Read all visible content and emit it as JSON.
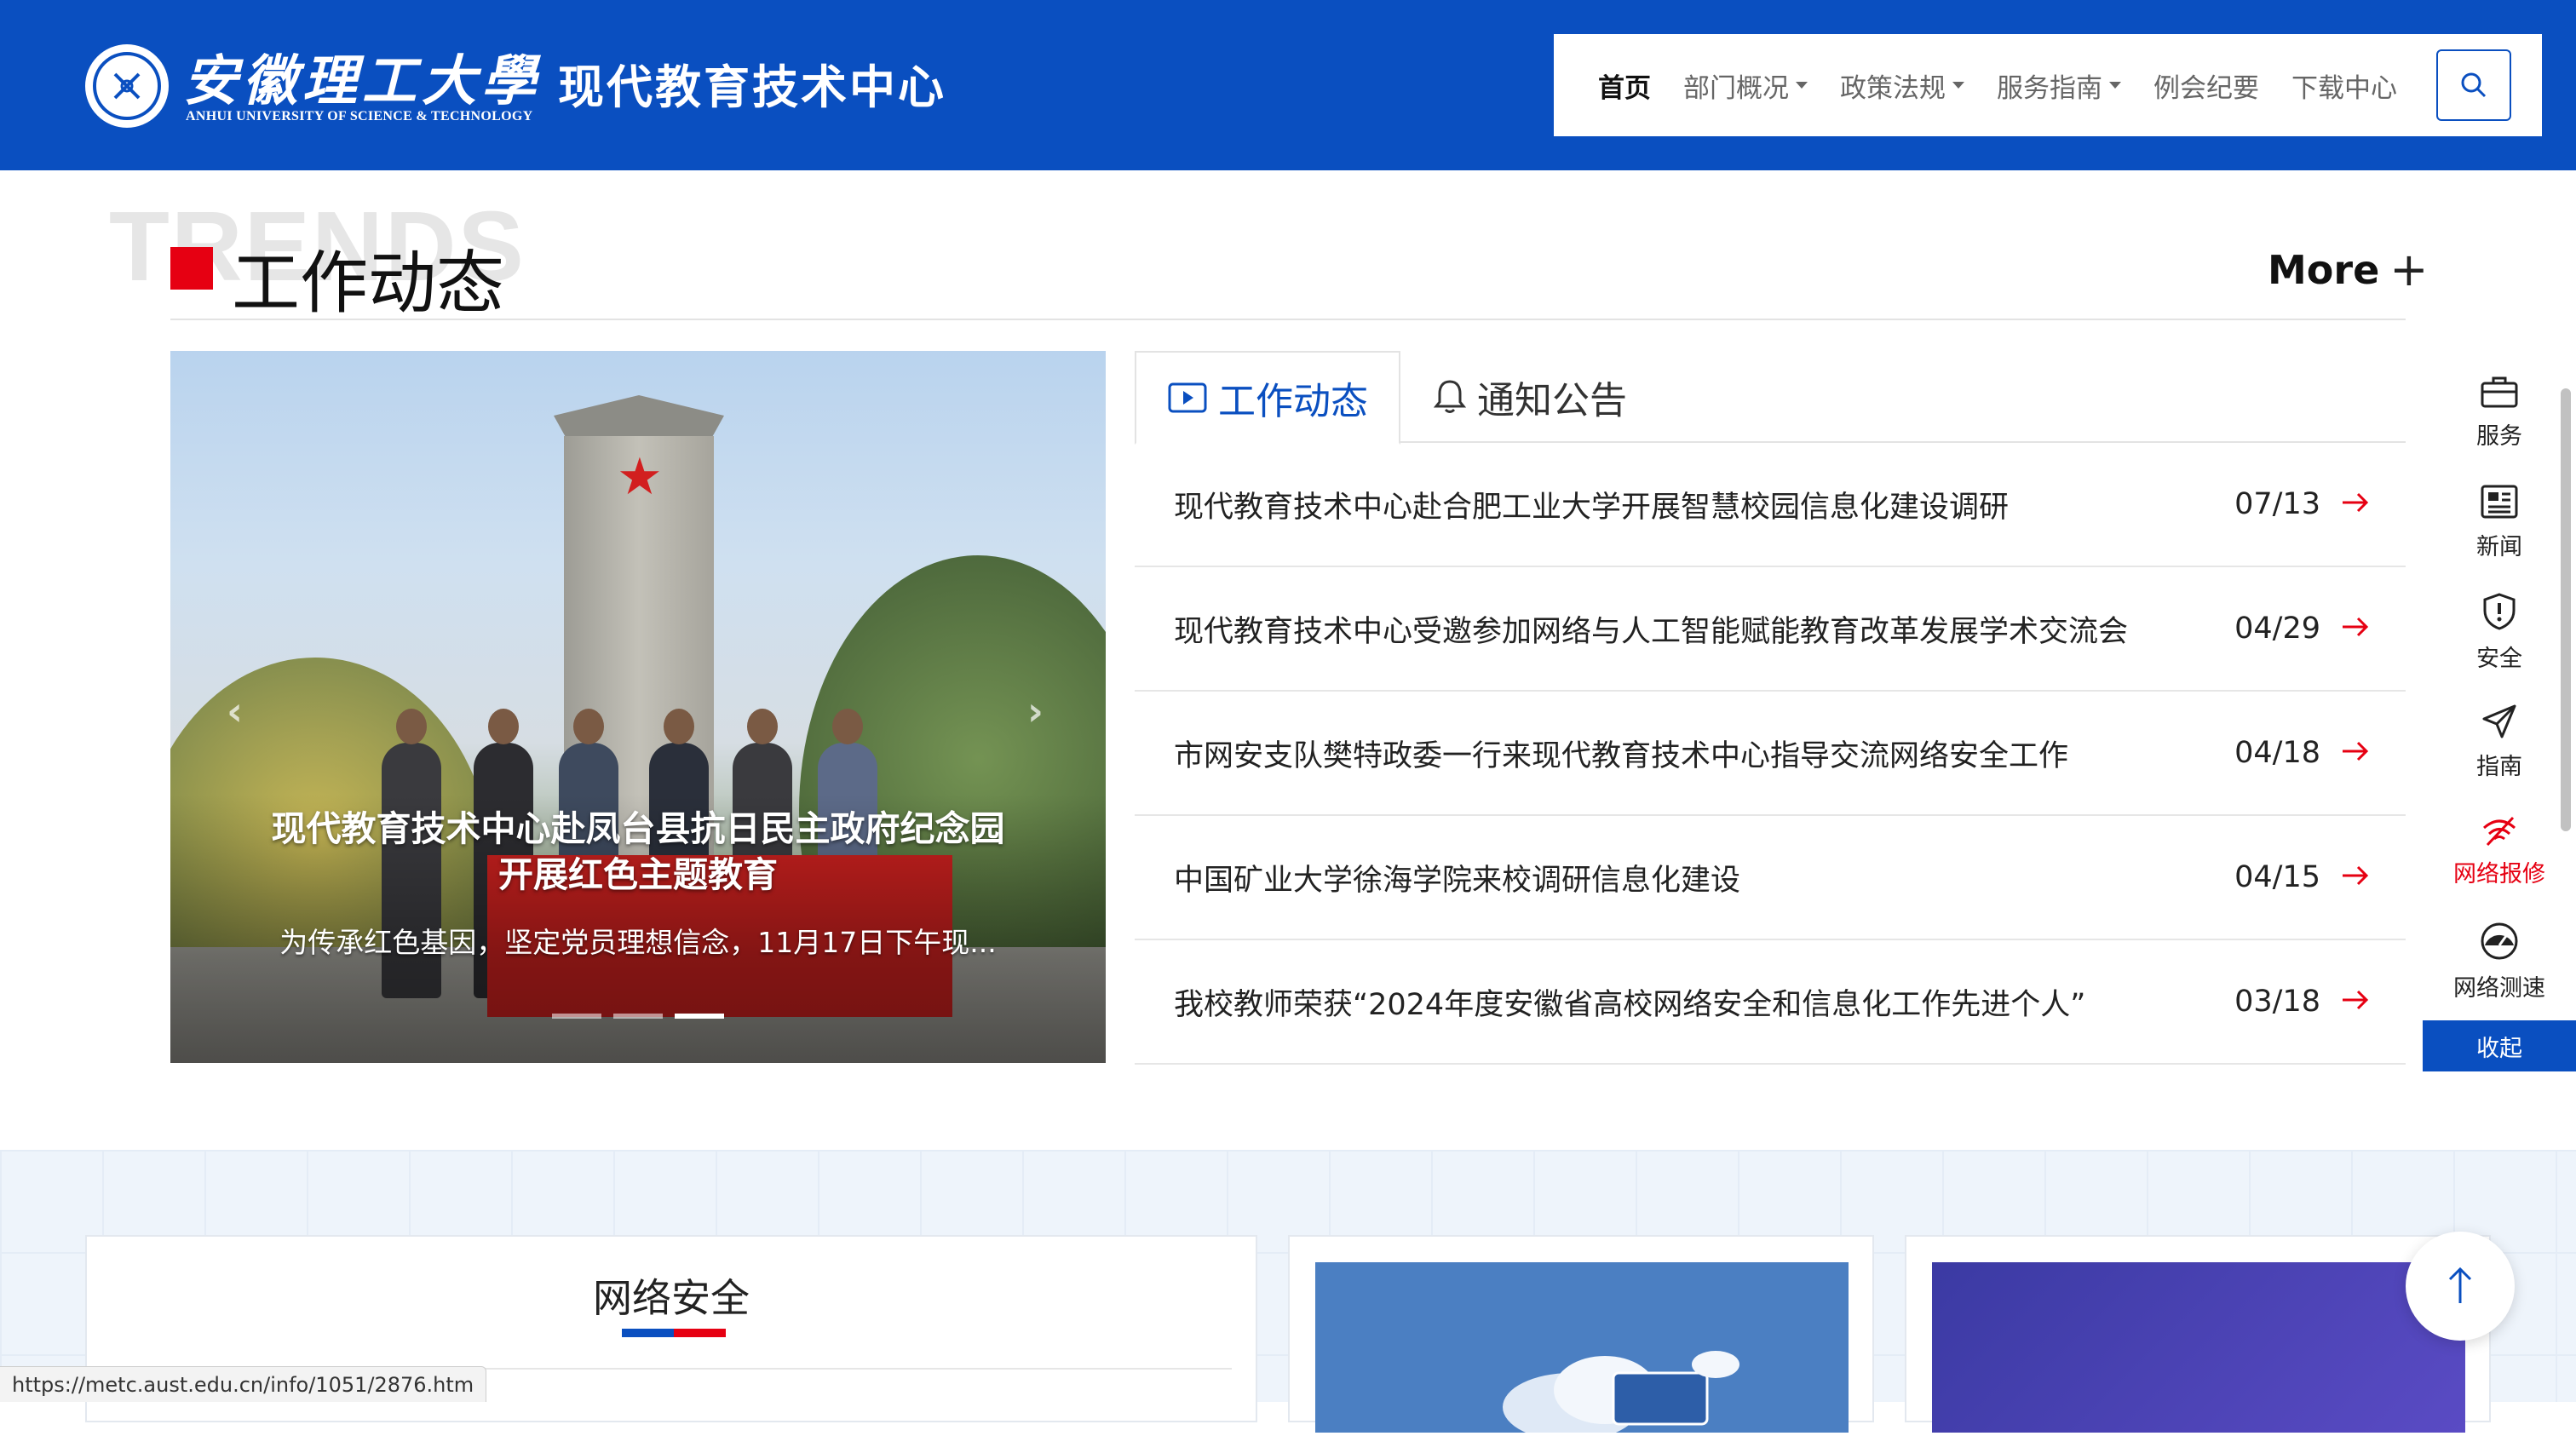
{
  "header": {
    "university_cn": "安徽理工大學",
    "university_en": "ANHUI UNIVERSITY OF SCIENCE & TECHNOLOGY",
    "site_name": "现代教育技术中心",
    "brand_color": "#0a4fc0"
  },
  "nav": {
    "items": [
      {
        "label": "首页",
        "active": true,
        "dropdown": false
      },
      {
        "label": "部门概况",
        "active": false,
        "dropdown": true
      },
      {
        "label": "政策法规",
        "active": false,
        "dropdown": true
      },
      {
        "label": "服务指南",
        "active": false,
        "dropdown": true
      },
      {
        "label": "例会纪要",
        "active": false,
        "dropdown": false
      },
      {
        "label": "下载中心",
        "active": false,
        "dropdown": false
      }
    ],
    "search_icon": "search-icon"
  },
  "section": {
    "bg_word": "TRENDS",
    "title": "工作动态",
    "more_label": "More",
    "more_plus": "+"
  },
  "slider": {
    "caption": "现代教育技术中心赴凤台县抗日民主政府纪念园开展红色主题教育",
    "summary": "为传承红色基因，坚定党员理想信念，11月17日下午现...",
    "prev_icon": "chevron-left-icon",
    "next_icon": "chevron-right-icon",
    "active_dot": 2,
    "dot_count": 3
  },
  "tabs": [
    {
      "label": "工作动态",
      "icon": "play-icon",
      "active": true
    },
    {
      "label": "通知公告",
      "icon": "bell-icon",
      "active": false
    }
  ],
  "news": [
    {
      "title": "现代教育技术中心赴合肥工业大学开展智慧校园信息化建设调研",
      "date": "07/13"
    },
    {
      "title": "现代教育技术中心受邀参加网络与人工智能赋能教育改革发展学术交流会",
      "date": "04/29"
    },
    {
      "title": "市网安支队樊特政委一行来现代教育技术中心指导交流网络安全工作",
      "date": "04/18"
    },
    {
      "title": "中国矿业大学徐海学院来校调研信息化建设",
      "date": "04/15"
    },
    {
      "title": "我校教师荣获“2024年度安徽省高校网络安全和信息化工作先进个人”",
      "date": "03/18"
    }
  ],
  "float_bar": {
    "items": [
      {
        "label": "服务",
        "icon": "briefcase-icon"
      },
      {
        "label": "新闻",
        "icon": "newspaper-icon"
      },
      {
        "label": "安全",
        "icon": "shield-icon"
      },
      {
        "label": "指南",
        "icon": "send-icon"
      },
      {
        "label": "网络报修",
        "icon": "wifi-off-icon",
        "highlight": true
      },
      {
        "label": "网络测速",
        "icon": "speedometer-icon"
      }
    ],
    "collapse_label": "收起"
  },
  "lower": {
    "card1_title": "网络安全"
  },
  "status_bar": {
    "url": "https://metc.aust.edu.cn/info/1051/2876.htm"
  },
  "colors": {
    "accent_red": "#e60012",
    "link_blue": "#0a4fc0"
  }
}
